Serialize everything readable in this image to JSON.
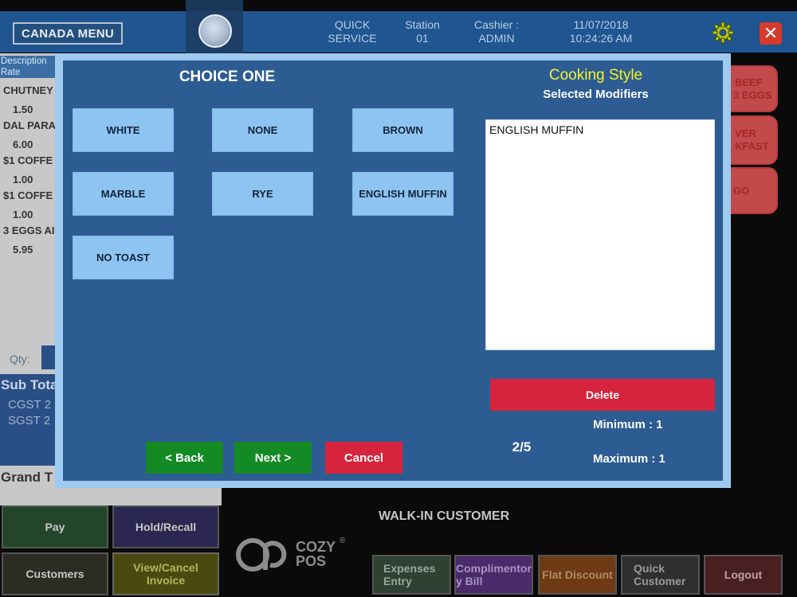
{
  "header": {
    "menu_label": "CANADA MENU",
    "service_l1": "QUICK",
    "service_l2": "SERVICE",
    "station_l1": "Station",
    "station_l2": "01",
    "cashier_l1": "Cashier :",
    "cashier_l2": "ADMIN",
    "date": "11/07/2018",
    "time": "10:24:26 AM",
    "close_symbol": "✕"
  },
  "left_panel": {
    "header_l1": "Description",
    "header_l2": "Rate",
    "items": [
      {
        "name": "CHUTNEY",
        "rate": "1.50"
      },
      {
        "name": "DAL PARA",
        "rate": "6.00"
      },
      {
        "name": "$1 COFFE",
        "rate": "1.00"
      },
      {
        "name": "$1 COFFE",
        "rate": "1.00"
      },
      {
        "name": "3 EGGS AI",
        "rate": "5.95"
      }
    ],
    "qty_label": "Qty:",
    "subtotal_label": "Sub Tota",
    "cgst_label": "CGST 2",
    "sgst_label": "SGST 2",
    "grand_label": "Grand T"
  },
  "right_side": {
    "item1_l1": "BEEF",
    "item1_l2": "3 EGGS",
    "item2_l1": "VER",
    "item2_l2": "KFAST",
    "item3": "GO"
  },
  "bottom": {
    "customer": "WALK-IN CUSTOMER",
    "pay": "Pay",
    "hold_recall": "Hold/Recall",
    "customers": "Customers",
    "view_cancel_l1": "View/Cancel",
    "view_cancel_l2": "Invoice",
    "expenses_l1": "Expenses",
    "expenses_l2": "Entry",
    "complimentary_l1": "Complimentor",
    "complimentary_l2": "y Bill",
    "flat_discount": "Flat Discount",
    "quick_customer_l1": "Quick",
    "quick_customer_l2": "Customer",
    "logout": "Logout",
    "logo_text_l1": "COZY",
    "logo_text_l2": "POS",
    "logo_reg": "®"
  },
  "modal": {
    "choice_title": "CHOICE ONE",
    "options": [
      "WHITE",
      "NONE",
      "BROWN",
      "MARBLE",
      "RYE",
      "ENGLISH MUFFIN",
      "NO TOAST"
    ],
    "cooking_style": "Cooking Style",
    "selected_modifiers": "Selected Modifiers",
    "selected_items": [
      "ENGLISH MUFFIN"
    ],
    "delete_label": "Delete",
    "minimum": "Minimum : 1",
    "maximum": "Maximum : 1",
    "page_indicator": "2/5",
    "back_label": "< Back",
    "next_label": "Next >",
    "cancel_label": "Cancel"
  },
  "colors": {
    "header_blue": "#1f5591",
    "modal_blue": "#2d5c93",
    "modal_border": "#9fcaf0",
    "option_button": "#8dc4f1",
    "green_button": "#138a23",
    "red_button": "#d5243b",
    "cooking_style_yellow": "#f3f32a"
  }
}
